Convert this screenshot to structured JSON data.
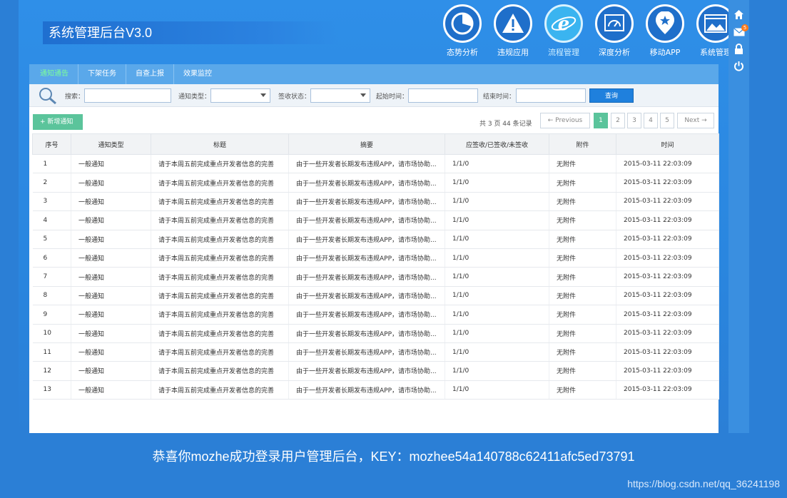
{
  "app": {
    "title": "系统管理后台V3.0"
  },
  "modules": [
    {
      "label": "态势分析",
      "icon": "pie-chart-icon"
    },
    {
      "label": "违规应用",
      "icon": "warning-icon"
    },
    {
      "label": "流程管理",
      "icon": "ie-browser-icon",
      "active": true
    },
    {
      "label": "深度分析",
      "icon": "gauge-icon"
    },
    {
      "label": "移动APP",
      "icon": "badge-star-icon"
    },
    {
      "label": "系统管理",
      "icon": "landscape-window-icon"
    }
  ],
  "rail": {
    "mail_badge": "5",
    "icons": [
      "home-icon",
      "mail-icon",
      "lock-icon",
      "power-icon"
    ]
  },
  "tabs": [
    {
      "label": "通知通告",
      "active": true
    },
    {
      "label": "下架任务"
    },
    {
      "label": "自查上报"
    },
    {
      "label": "效果监控"
    }
  ],
  "filters": {
    "search_label": "搜索：",
    "type_label": "通知类型：",
    "sign_label": "签收状态：",
    "start_label": "起始时间：",
    "end_label": "结束时间：",
    "query_label": "查询"
  },
  "actions": {
    "add_label": "+ 新增通知"
  },
  "pagination": {
    "info": "共 3 页 44 条记录",
    "prev": "← Previous",
    "pages": [
      "1",
      "2",
      "3",
      "4",
      "5"
    ],
    "next": "Next →",
    "current": "1"
  },
  "table": {
    "headers": [
      "序号",
      "通知类型",
      "标题",
      "摘要",
      "应签收/已签收/未签收",
      "附件",
      "时间"
    ],
    "rows": [
      [
        "1",
        "一般通知",
        "请于本周五前完成重点开发者信息的完善",
        "由于一些开发者长期发布违规APP，请市场协助...",
        "1/1/0",
        "无附件",
        "2015-03-11 22:03:09"
      ],
      [
        "2",
        "一般通知",
        "请于本周五前完成重点开发者信息的完善",
        "由于一些开发者长期发布违规APP，请市场协助...",
        "1/1/0",
        "无附件",
        "2015-03-11 22:03:09"
      ],
      [
        "3",
        "一般通知",
        "请于本周五前完成重点开发者信息的完善",
        "由于一些开发者长期发布违规APP，请市场协助...",
        "1/1/0",
        "无附件",
        "2015-03-11 22:03:09"
      ],
      [
        "4",
        "一般通知",
        "请于本周五前完成重点开发者信息的完善",
        "由于一些开发者长期发布违规APP，请市场协助...",
        "1/1/0",
        "无附件",
        "2015-03-11 22:03:09"
      ],
      [
        "5",
        "一般通知",
        "请于本周五前完成重点开发者信息的完善",
        "由于一些开发者长期发布违规APP，请市场协助...",
        "1/1/0",
        "无附件",
        "2015-03-11 22:03:09"
      ],
      [
        "6",
        "一般通知",
        "请于本周五前完成重点开发者信息的完善",
        "由于一些开发者长期发布违规APP，请市场协助...",
        "1/1/0",
        "无附件",
        "2015-03-11 22:03:09"
      ],
      [
        "7",
        "一般通知",
        "请于本周五前完成重点开发者信息的完善",
        "由于一些开发者长期发布违规APP，请市场协助...",
        "1/1/0",
        "无附件",
        "2015-03-11 22:03:09"
      ],
      [
        "8",
        "一般通知",
        "请于本周五前完成重点开发者信息的完善",
        "由于一些开发者长期发布违规APP，请市场协助...",
        "1/1/0",
        "无附件",
        "2015-03-11 22:03:09"
      ],
      [
        "9",
        "一般通知",
        "请于本周五前完成重点开发者信息的完善",
        "由于一些开发者长期发布违规APP，请市场协助...",
        "1/1/0",
        "无附件",
        "2015-03-11 22:03:09"
      ],
      [
        "10",
        "一般通知",
        "请于本周五前完成重点开发者信息的完善",
        "由于一些开发者长期发布违规APP，请市场协助...",
        "1/1/0",
        "无附件",
        "2015-03-11 22:03:09"
      ],
      [
        "11",
        "一般通知",
        "请于本周五前完成重点开发者信息的完善",
        "由于一些开发者长期发布违规APP，请市场协助...",
        "1/1/0",
        "无附件",
        "2015-03-11 22:03:09"
      ],
      [
        "12",
        "一般通知",
        "请于本周五前完成重点开发者信息的完善",
        "由于一些开发者长期发布违规APP，请市场协助...",
        "1/1/0",
        "无附件",
        "2015-03-11 22:03:09"
      ],
      [
        "13",
        "一般通知",
        "请于本周五前完成重点开发者信息的完善",
        "由于一些开发者长期发布违规APP，请市场协助...",
        "1/1/0",
        "无附件",
        "2015-03-11 22:03:09"
      ]
    ]
  },
  "footer": {
    "welcome": "恭喜你mozhe成功登录用户管理后台，KEY：mozhee54a140788c62411afc5ed73791",
    "watermark": "https://blog.csdn.net/qq_36241198"
  }
}
